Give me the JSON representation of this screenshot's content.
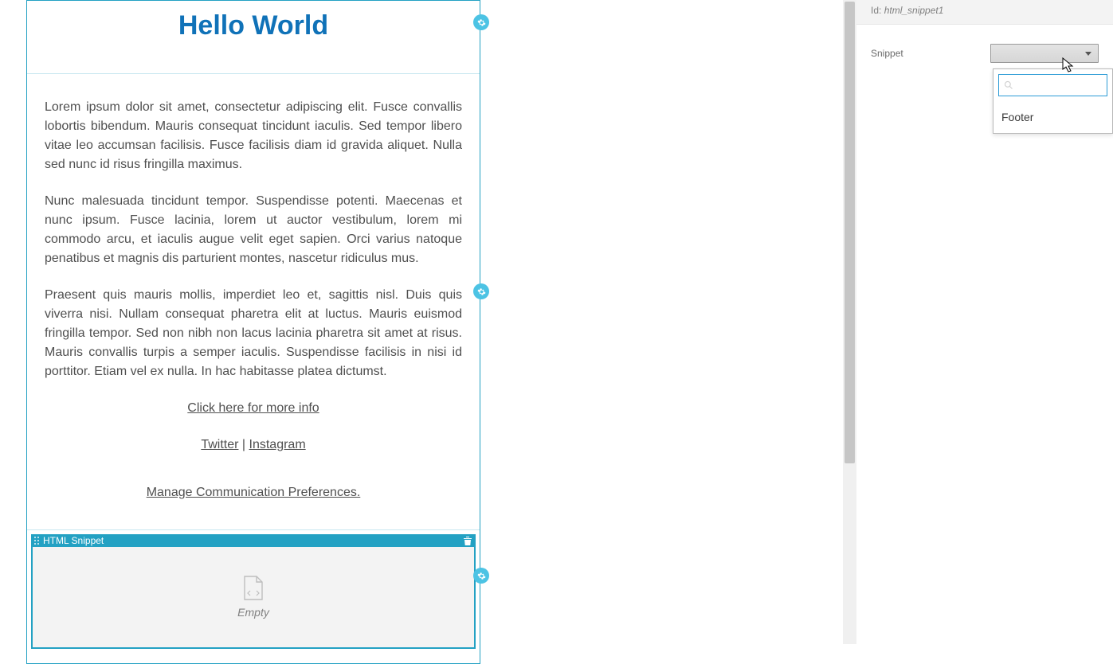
{
  "title": "Hello World",
  "body": {
    "p1": "Lorem ipsum dolor sit amet, consectetur adipiscing elit. Fusce convallis lobortis bibendum. Mauris consequat tincidunt iaculis. Sed tempor libero vitae leo accumsan facilisis. Fusce facilisis diam id gravida aliquet. Nulla sed nunc id risus fringilla maximus.",
    "p2": "Nunc malesuada tincidunt tempor. Suspendisse potenti. Maecenas et nunc ipsum. Fusce lacinia, lorem ut auctor vestibulum, lorem mi commodo arcu, et iaculis augue velit eget sapien. Orci varius natoque penatibus et magnis dis parturient montes, nascetur ridiculus mus.",
    "p3": "Praesent quis mauris mollis, imperdiet leo et, sagittis nisl. Duis quis viverra nisi. Nullam consequat pharetra elit at luctus. Mauris euismod fringilla tempor. Sed non nibh non lacus lacinia pharetra sit amet at risus. Mauris convallis turpis a semper iaculis. Suspendisse facilisis in nisi id porttitor. Etiam vel ex nulla. In hac habitasse platea dictumst.",
    "more_info": "Click here for more info",
    "twitter": "Twitter",
    "separator": " | ",
    "instagram": "Instagram",
    "preferences": "Manage Communication Preferences."
  },
  "snippet_block": {
    "header": "HTML Snippet",
    "empty": "Empty"
  },
  "panel": {
    "id_label": "Id:",
    "id_value": "html_snippet1",
    "snippet_label": "Snippet"
  },
  "dropdown": {
    "search_placeholder": "",
    "options": [
      "Footer"
    ]
  }
}
